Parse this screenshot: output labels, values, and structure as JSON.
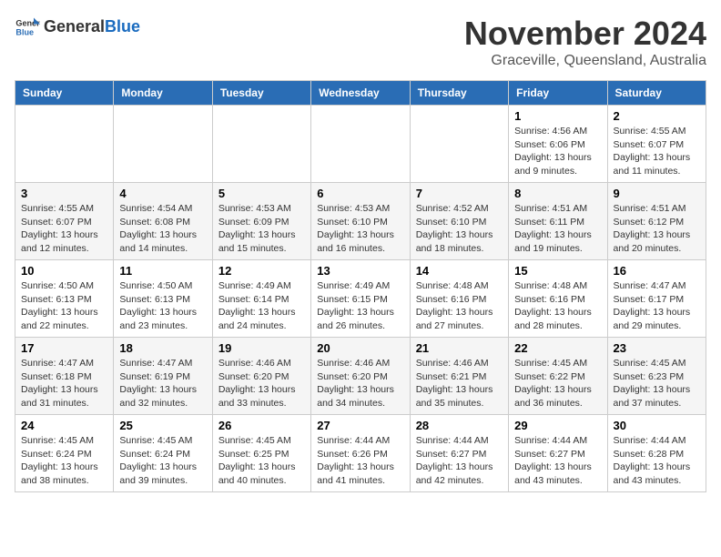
{
  "logo": {
    "general": "General",
    "blue": "Blue"
  },
  "header": {
    "month": "November 2024",
    "location": "Graceville, Queensland, Australia"
  },
  "weekdays": [
    "Sunday",
    "Monday",
    "Tuesday",
    "Wednesday",
    "Thursday",
    "Friday",
    "Saturday"
  ],
  "weeks": [
    [
      {
        "day": "",
        "info": ""
      },
      {
        "day": "",
        "info": ""
      },
      {
        "day": "",
        "info": ""
      },
      {
        "day": "",
        "info": ""
      },
      {
        "day": "",
        "info": ""
      },
      {
        "day": "1",
        "info": "Sunrise: 4:56 AM\nSunset: 6:06 PM\nDaylight: 13 hours and 9 minutes."
      },
      {
        "day": "2",
        "info": "Sunrise: 4:55 AM\nSunset: 6:07 PM\nDaylight: 13 hours and 11 minutes."
      }
    ],
    [
      {
        "day": "3",
        "info": "Sunrise: 4:55 AM\nSunset: 6:07 PM\nDaylight: 13 hours and 12 minutes."
      },
      {
        "day": "4",
        "info": "Sunrise: 4:54 AM\nSunset: 6:08 PM\nDaylight: 13 hours and 14 minutes."
      },
      {
        "day": "5",
        "info": "Sunrise: 4:53 AM\nSunset: 6:09 PM\nDaylight: 13 hours and 15 minutes."
      },
      {
        "day": "6",
        "info": "Sunrise: 4:53 AM\nSunset: 6:10 PM\nDaylight: 13 hours and 16 minutes."
      },
      {
        "day": "7",
        "info": "Sunrise: 4:52 AM\nSunset: 6:10 PM\nDaylight: 13 hours and 18 minutes."
      },
      {
        "day": "8",
        "info": "Sunrise: 4:51 AM\nSunset: 6:11 PM\nDaylight: 13 hours and 19 minutes."
      },
      {
        "day": "9",
        "info": "Sunrise: 4:51 AM\nSunset: 6:12 PM\nDaylight: 13 hours and 20 minutes."
      }
    ],
    [
      {
        "day": "10",
        "info": "Sunrise: 4:50 AM\nSunset: 6:13 PM\nDaylight: 13 hours and 22 minutes."
      },
      {
        "day": "11",
        "info": "Sunrise: 4:50 AM\nSunset: 6:13 PM\nDaylight: 13 hours and 23 minutes."
      },
      {
        "day": "12",
        "info": "Sunrise: 4:49 AM\nSunset: 6:14 PM\nDaylight: 13 hours and 24 minutes."
      },
      {
        "day": "13",
        "info": "Sunrise: 4:49 AM\nSunset: 6:15 PM\nDaylight: 13 hours and 26 minutes."
      },
      {
        "day": "14",
        "info": "Sunrise: 4:48 AM\nSunset: 6:16 PM\nDaylight: 13 hours and 27 minutes."
      },
      {
        "day": "15",
        "info": "Sunrise: 4:48 AM\nSunset: 6:16 PM\nDaylight: 13 hours and 28 minutes."
      },
      {
        "day": "16",
        "info": "Sunrise: 4:47 AM\nSunset: 6:17 PM\nDaylight: 13 hours and 29 minutes."
      }
    ],
    [
      {
        "day": "17",
        "info": "Sunrise: 4:47 AM\nSunset: 6:18 PM\nDaylight: 13 hours and 31 minutes."
      },
      {
        "day": "18",
        "info": "Sunrise: 4:47 AM\nSunset: 6:19 PM\nDaylight: 13 hours and 32 minutes."
      },
      {
        "day": "19",
        "info": "Sunrise: 4:46 AM\nSunset: 6:20 PM\nDaylight: 13 hours and 33 minutes."
      },
      {
        "day": "20",
        "info": "Sunrise: 4:46 AM\nSunset: 6:20 PM\nDaylight: 13 hours and 34 minutes."
      },
      {
        "day": "21",
        "info": "Sunrise: 4:46 AM\nSunset: 6:21 PM\nDaylight: 13 hours and 35 minutes."
      },
      {
        "day": "22",
        "info": "Sunrise: 4:45 AM\nSunset: 6:22 PM\nDaylight: 13 hours and 36 minutes."
      },
      {
        "day": "23",
        "info": "Sunrise: 4:45 AM\nSunset: 6:23 PM\nDaylight: 13 hours and 37 minutes."
      }
    ],
    [
      {
        "day": "24",
        "info": "Sunrise: 4:45 AM\nSunset: 6:24 PM\nDaylight: 13 hours and 38 minutes."
      },
      {
        "day": "25",
        "info": "Sunrise: 4:45 AM\nSunset: 6:24 PM\nDaylight: 13 hours and 39 minutes."
      },
      {
        "day": "26",
        "info": "Sunrise: 4:45 AM\nSunset: 6:25 PM\nDaylight: 13 hours and 40 minutes."
      },
      {
        "day": "27",
        "info": "Sunrise: 4:44 AM\nSunset: 6:26 PM\nDaylight: 13 hours and 41 minutes."
      },
      {
        "day": "28",
        "info": "Sunrise: 4:44 AM\nSunset: 6:27 PM\nDaylight: 13 hours and 42 minutes."
      },
      {
        "day": "29",
        "info": "Sunrise: 4:44 AM\nSunset: 6:27 PM\nDaylight: 13 hours and 43 minutes."
      },
      {
        "day": "30",
        "info": "Sunrise: 4:44 AM\nSunset: 6:28 PM\nDaylight: 13 hours and 43 minutes."
      }
    ]
  ]
}
